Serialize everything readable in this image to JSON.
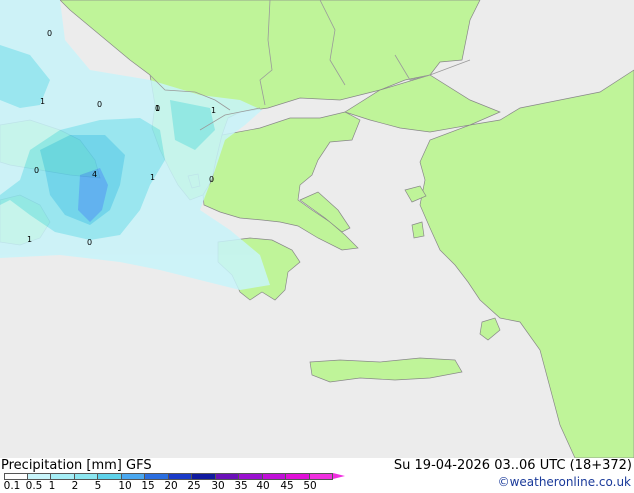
{
  "map": {
    "colors": {
      "sea": "#ececec",
      "land": "#bff499",
      "coast": "#888888",
      "border": "#9a9a9a",
      "precip_light": "#c8f4fa",
      "precip_mid": "#8ce6f0",
      "precip_strong": "#5ed2ea",
      "precip_heavy": "#4aa8f0"
    },
    "contour_values": [
      "0",
      "1",
      "0",
      "1",
      "1",
      "0",
      "4",
      "1",
      "0",
      "1",
      "0",
      "0"
    ]
  },
  "footer": {
    "title": "Precipitation [mm] GFS",
    "timestamp": "Su 19-04-2026 03..06 UTC (18+372)",
    "credit": "©weatheronline.co.uk"
  },
  "legend": {
    "labels": [
      "0.1",
      "0.5",
      "1",
      "2",
      "5",
      "10",
      "15",
      "20",
      "25",
      "30",
      "35",
      "40",
      "45",
      "50"
    ],
    "colors": [
      "#ffffff",
      "#c8f4fa",
      "#a6eef6",
      "#8ce6f0",
      "#5ed2ea",
      "#4aa8f0",
      "#2a6ee0",
      "#1a3ac8",
      "#101aa0",
      "#6a10b8",
      "#9a10d0",
      "#c010d8",
      "#e010d8",
      "#f030e0"
    ]
  }
}
